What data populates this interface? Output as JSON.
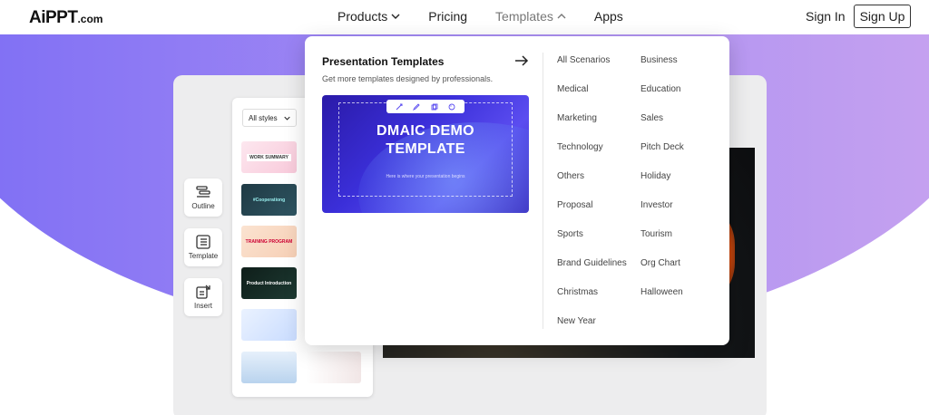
{
  "header": {
    "logo_main": "AiPPT",
    "logo_suffix": ".com",
    "nav": [
      {
        "label": "Products"
      },
      {
        "label": "Pricing"
      },
      {
        "label": "Templates"
      },
      {
        "label": "Apps"
      }
    ],
    "sign_in": "Sign In",
    "sign_up": "Sign Up"
  },
  "editor": {
    "tools": [
      {
        "label": "Outline",
        "icon": "outline-icon"
      },
      {
        "label": "Template",
        "icon": "template-icon"
      },
      {
        "label": "Insert",
        "icon": "insert-icon"
      }
    ],
    "style_filter": "All styles",
    "thumbnails": [
      {
        "label": "WORK SUMMARY"
      },
      {
        "label": "#Cooperationg"
      },
      {
        "label": "TRAINING PROGRAM"
      },
      {
        "label": "Product Introduction"
      },
      {
        "label": ""
      },
      {
        "label": ""
      },
      {
        "label": ""
      }
    ]
  },
  "dropdown": {
    "title": "Presentation Templates",
    "subtitle": "Get more templates designed by professionals.",
    "preview": {
      "headline_1": "DMAIC DEMO",
      "headline_2": "TEMPLATE",
      "tagline": "Here is where your presentation begins"
    },
    "col1": [
      "All Scenarios",
      "Medical",
      "Marketing",
      "Technology",
      "Others",
      "Proposal",
      "Sports",
      "Brand Guidelines",
      "Christmas",
      "New Year"
    ],
    "col2": [
      "Business",
      "Education",
      "Sales",
      "Pitch Deck",
      "Holiday",
      "Investor",
      "Tourism",
      "Org Chart",
      "Halloween"
    ]
  }
}
